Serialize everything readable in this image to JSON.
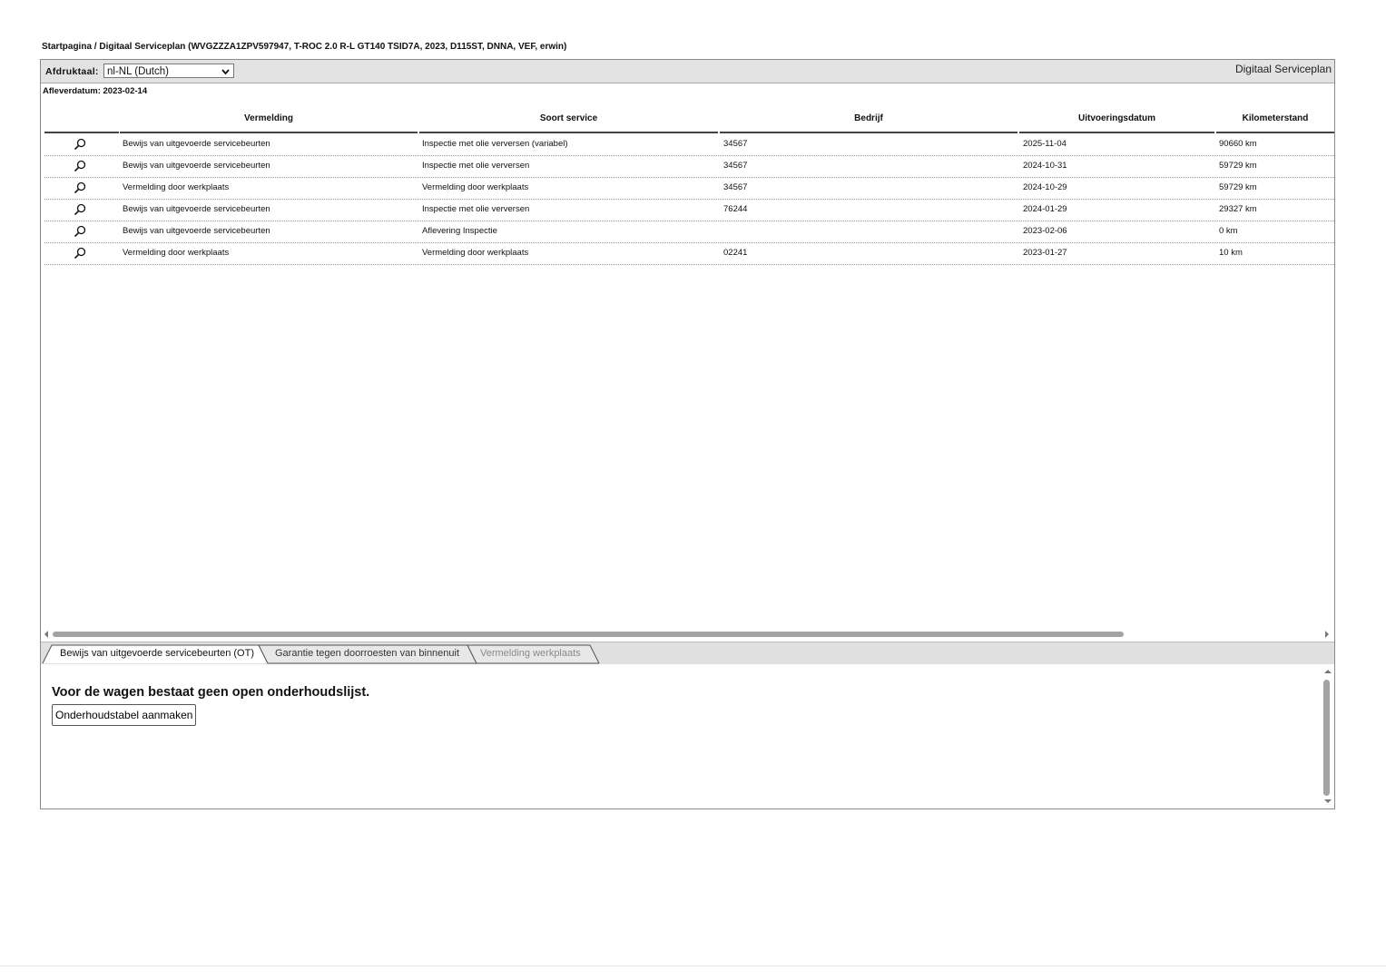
{
  "breadcrumb": "Startpagina / Digitaal Serviceplan (WVGZZZA1ZPV597947, T-ROC 2.0 R-L GT140 TSID7A, 2023, D115ST, DNNA, VEF, erwin)",
  "toolbar": {
    "language_label": "Afdruktaal:",
    "language_value": "nl-NL (Dutch)",
    "app_title": "Digitaal Serviceplan"
  },
  "delivery_date": "Afleverdatum: 2023-02-14",
  "table": {
    "headers": [
      "Vermelding",
      "Soort service",
      "Bedrijf",
      "Uitvoeringsdatum",
      "Kilometerstand"
    ],
    "rows": [
      {
        "vermelding": "Bewijs van uitgevoerde servicebeurten",
        "soort": "Inspectie met olie verversen (variabel)",
        "bedrijf": "34567",
        "datum": "2025-11-04",
        "km": "90660 km"
      },
      {
        "vermelding": "Bewijs van uitgevoerde servicebeurten",
        "soort": "Inspectie met olie verversen",
        "bedrijf": "34567",
        "datum": "2024-10-31",
        "km": "59729 km"
      },
      {
        "vermelding": "Vermelding door werkplaats",
        "soort": "Vermelding door werkplaats",
        "bedrijf": "34567",
        "datum": "2024-10-29",
        "km": "59729 km"
      },
      {
        "vermelding": "Bewijs van uitgevoerde servicebeurten",
        "soort": "Inspectie met olie verversen",
        "bedrijf": "76244",
        "datum": "2024-01-29",
        "km": "29327 km"
      },
      {
        "vermelding": "Bewijs van uitgevoerde servicebeurten",
        "soort": "Aflevering Inspectie",
        "bedrijf": "",
        "datum": "2023-02-06",
        "km": "0 km"
      },
      {
        "vermelding": "Vermelding door werkplaats",
        "soort": "Vermelding door werkplaats",
        "bedrijf": "02241",
        "datum": "2023-01-27",
        "km": "10 km"
      }
    ]
  },
  "tabs": [
    {
      "label": "Bewijs van uitgevoerde servicebeurten (OT)",
      "state": "active"
    },
    {
      "label": "Garantie tegen doorroesten van binnenuit",
      "state": "normal"
    },
    {
      "label": "Vermelding werkplaats",
      "state": "disabled"
    }
  ],
  "maintenance": {
    "message": "Voor de wagen bestaat geen open onderhoudslijst.",
    "button_label": "Onderhoudstabel aanmaken"
  },
  "icons": {
    "row_icon": "magnifier-icon",
    "select_icon": "chevron-down-icon",
    "scroll_left": "arrow-left-icon",
    "scroll_right": "arrow-right-icon",
    "scroll_up": "arrow-up-icon",
    "scroll_down": "arrow-down-icon"
  }
}
